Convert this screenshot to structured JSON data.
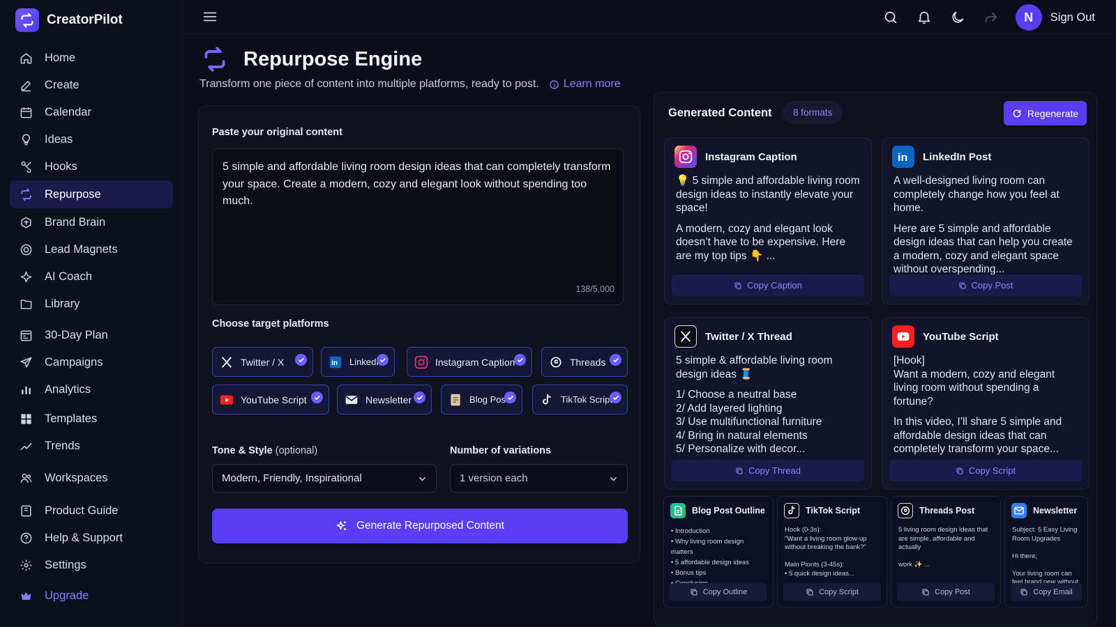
{
  "app": {
    "name": "CreatorPilot",
    "accent": "#5a3df2"
  },
  "sidebar": {
    "items": [
      {
        "label": "Home",
        "icon": "home-icon"
      },
      {
        "label": "Create",
        "icon": "pencil-icon"
      },
      {
        "label": "Calendar",
        "icon": "calendar-icon"
      },
      {
        "label": "Ideas",
        "icon": "lightbulb-icon"
      },
      {
        "label": "Hooks",
        "icon": "hook-icon"
      },
      {
        "label": "Repurpose",
        "icon": "repurpose-icon",
        "active": true
      },
      {
        "label": "Brand Brain",
        "icon": "brain-icon"
      },
      {
        "label": "Lead Magnets",
        "icon": "magnet-icon"
      },
      {
        "label": "AI Coach",
        "icon": "ai-coach-icon"
      },
      {
        "label": "Library",
        "icon": "folder-icon"
      },
      {
        "label": "30-Day Plan",
        "icon": "plan-icon"
      },
      {
        "label": "Campaigns",
        "icon": "send-icon"
      },
      {
        "label": "Analytics",
        "icon": "bar-chart-icon"
      },
      {
        "label": "Templates",
        "icon": "templates-icon"
      },
      {
        "label": "Trends",
        "icon": "trend-icon"
      },
      {
        "label": "Workspaces",
        "icon": "users-icon"
      },
      {
        "label": "Product Guide",
        "icon": "book-icon"
      },
      {
        "label": "Help & Support",
        "icon": "help-icon"
      },
      {
        "label": "Settings",
        "icon": "gear-icon"
      },
      {
        "label": "Upgrade",
        "icon": "crown-icon"
      }
    ]
  },
  "topbar": {
    "avatar_initial": "N",
    "sign_out": "Sign Out"
  },
  "page": {
    "title": "Repurpose Engine",
    "subtitle": "Transform one piece of content into multiple platforms, ready to post.",
    "learn_more": "Learn more"
  },
  "input": {
    "label": "Paste your original content",
    "value": "5 simple and affordable living room design ideas that can completely transform your space. Create a modern, cozy and elegant look without spending too much.",
    "counter": "138/5,000"
  },
  "platforms": {
    "label": "Choose target platforms",
    "items": [
      {
        "label": "Twitter / X",
        "icon": "x-icon",
        "checked": true
      },
      {
        "label": "LinkedIn",
        "icon": "linkedin-icon",
        "checked": true
      },
      {
        "label": "Instagram Caption",
        "icon": "instagram-icon",
        "checked": true
      },
      {
        "label": "Threads",
        "icon": "threads-icon",
        "checked": true
      },
      {
        "label": "YouTube Script",
        "icon": "youtube-icon",
        "checked": true
      },
      {
        "label": "Newsletter",
        "icon": "mail-icon",
        "checked": true
      },
      {
        "label": "Blog Post",
        "icon": "blog-icon",
        "checked": true
      },
      {
        "label": "TikTok Script",
        "icon": "tiktok-icon",
        "checked": true
      }
    ]
  },
  "tone": {
    "label": "Tone & Style",
    "optional": "(optional)",
    "value": "Modern, Friendly, Inspirational"
  },
  "variations": {
    "label": "Number of variations",
    "value": "1 version each"
  },
  "generate_button": "Generate Repurposed Content",
  "generated": {
    "title": "Generated Content",
    "badge": "8 formats",
    "regenerate": "Regenerate",
    "cards": [
      {
        "title": "Instagram Caption",
        "paragraphs": [
          "💡 5 simple and affordable living room design ideas to instantly elevate your space!",
          "A modern, cozy and elegant look doesn’t have to be expensive. Here are my top tips 👇 ..."
        ],
        "copy": "Copy Caption"
      },
      {
        "title": "LinkedIn Post",
        "paragraphs": [
          "A well-designed living room can completely change how you feel at home.",
          "Here are 5 simple and affordable design ideas that can help you create a modern, cozy and elegant space without overspending..."
        ],
        "copy": "Copy Post"
      },
      {
        "title": "Twitter / X Thread",
        "paragraphs": [
          "5 simple & affordable living room design ideas 🧵",
          "1/ Choose a neutral base\n2/ Add layered lighting\n3/ Use multifunctional furniture\n4/ Bring in natural elements\n5/ Personalize with decor..."
        ],
        "copy": "Copy Thread"
      },
      {
        "title": "YouTube Script",
        "paragraphs": [
          "[Hook]\nWant a modern, cozy and elegant living room without spending a fortune?",
          "In this video, I’ll share 5 simple and affordable design ideas that can completely transform your space..."
        ],
        "copy": "Copy Script"
      }
    ],
    "mini_cards": [
      {
        "title": "Blog Post Outline",
        "body": "• Introduction\n• Why living room design matters\n• 5 affordable design ideas\n• Bonus tips\n• Conclusion",
        "copy": "Copy Outline"
      },
      {
        "title": "TikTok Script",
        "body": "Hook (0-3s):\n\"Want a living room glow-up without breaking the bank?\"\n\nMain Pionts (3-45s):\n• 5 quick design ideas...",
        "copy": "Copy Script"
      },
      {
        "title": "Threads Post",
        "body": "5 living room design ideas that are simple, affordable and actually\n\nwork ✨ ...",
        "copy": "Copy Post"
      },
      {
        "title": "Newsletter",
        "body": "Subject: 5 Easy Living Room Upgrades\n\nHi there,\n\nYour living room can feel brand new without spending a fortune...",
        "copy": "Copy Email"
      }
    ]
  }
}
